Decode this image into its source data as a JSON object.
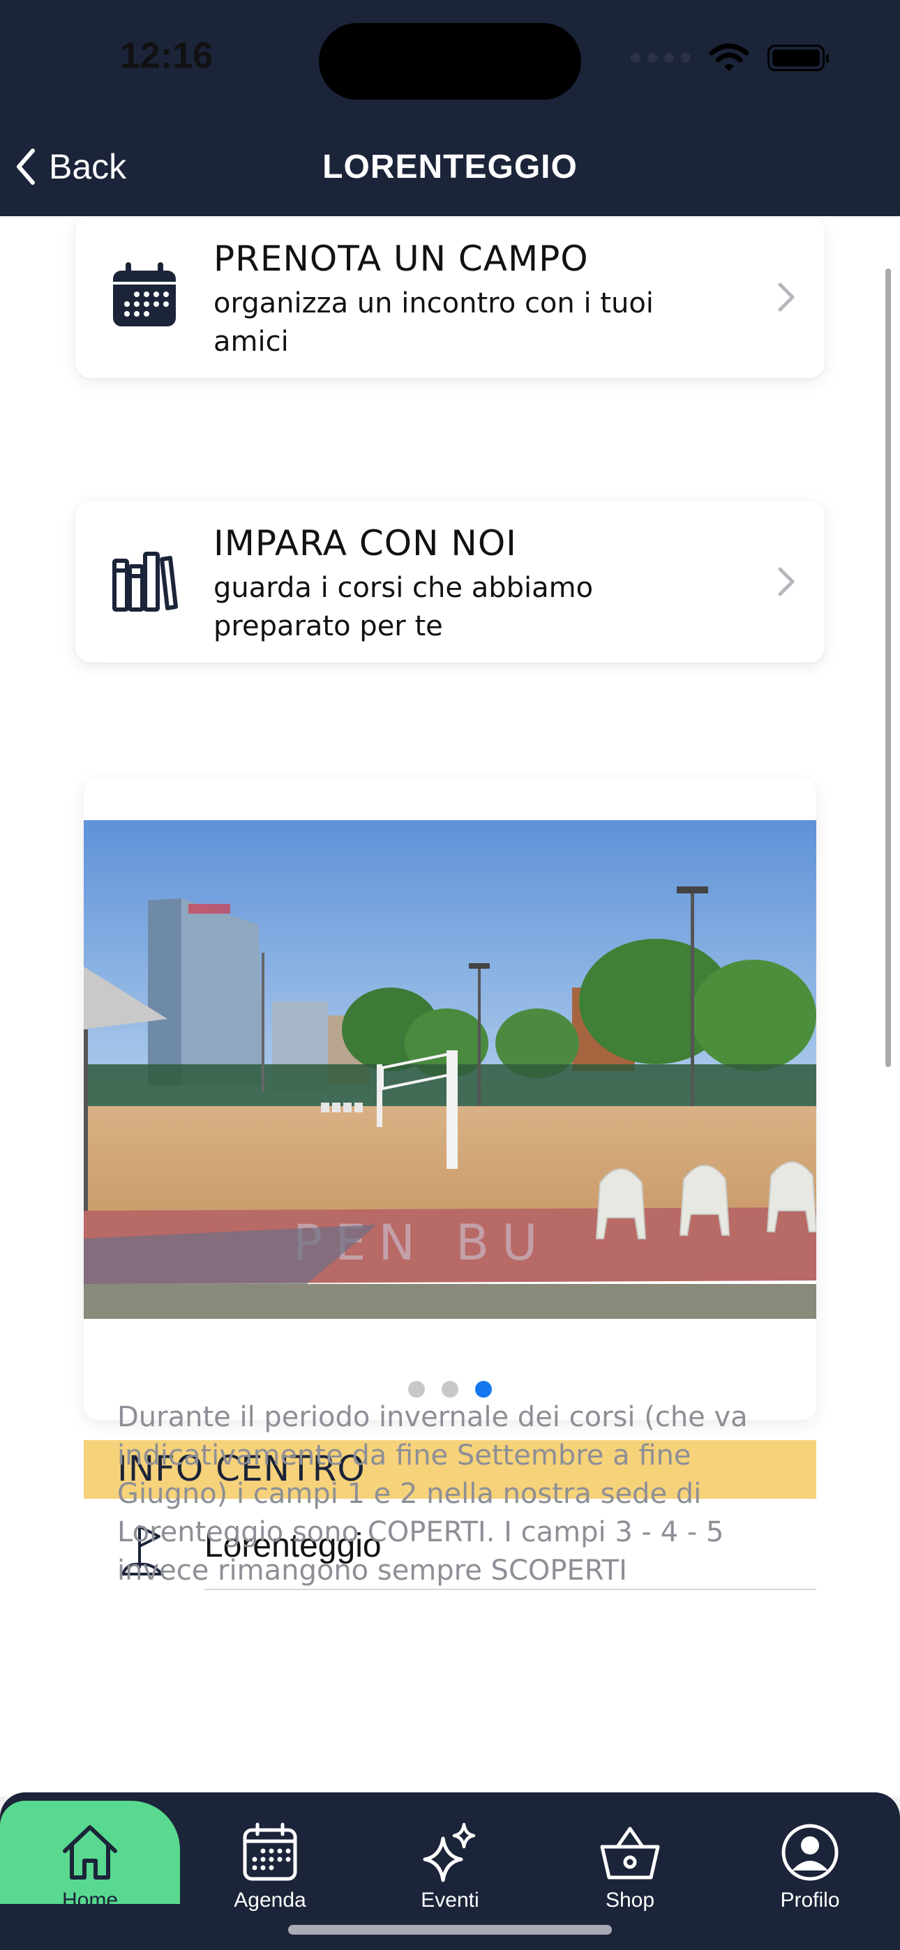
{
  "status_bar": {
    "time": "12:16"
  },
  "nav": {
    "back_label": "Back",
    "title": "LORENTEGGIO"
  },
  "cards": [
    {
      "title": "PRENOTA UN CAMPO",
      "subtitle": "organizza un incontro con i tuoi amici",
      "icon": "calendar-icon"
    },
    {
      "title": "IMPARA CON NOI",
      "subtitle": "guarda i corsi che abbiamo preparato per te",
      "icon": "books-icon"
    }
  ],
  "gallery": {
    "pages": 3,
    "active_page": 3
  },
  "info": {
    "heading": "INFO CENTRO",
    "location": "Lorenteggio",
    "description": "Durante il periodo invernale dei corsi (che va indicativamente da fine Settembre a fine Giugno) i campi 1 e 2 nella nostra sede di Lorenteggio sono COPERTI. I campi 3 - 4 - 5 invece rimangono sempre SCOPERTI"
  },
  "tabbar": {
    "tabs": [
      {
        "label": "Home",
        "icon": "home-icon",
        "active": true
      },
      {
        "label": "Agenda",
        "icon": "calendar-icon"
      },
      {
        "label": "Eventi",
        "icon": "sparkles-icon"
      },
      {
        "label": "Shop",
        "icon": "basket-icon"
      },
      {
        "label": "Profilo",
        "icon": "profile-icon"
      }
    ]
  },
  "colors": {
    "navy": "#1b2438",
    "accent_green": "#58d98f",
    "info_band": "#f6d27a",
    "pager_active": "#1478f0"
  }
}
